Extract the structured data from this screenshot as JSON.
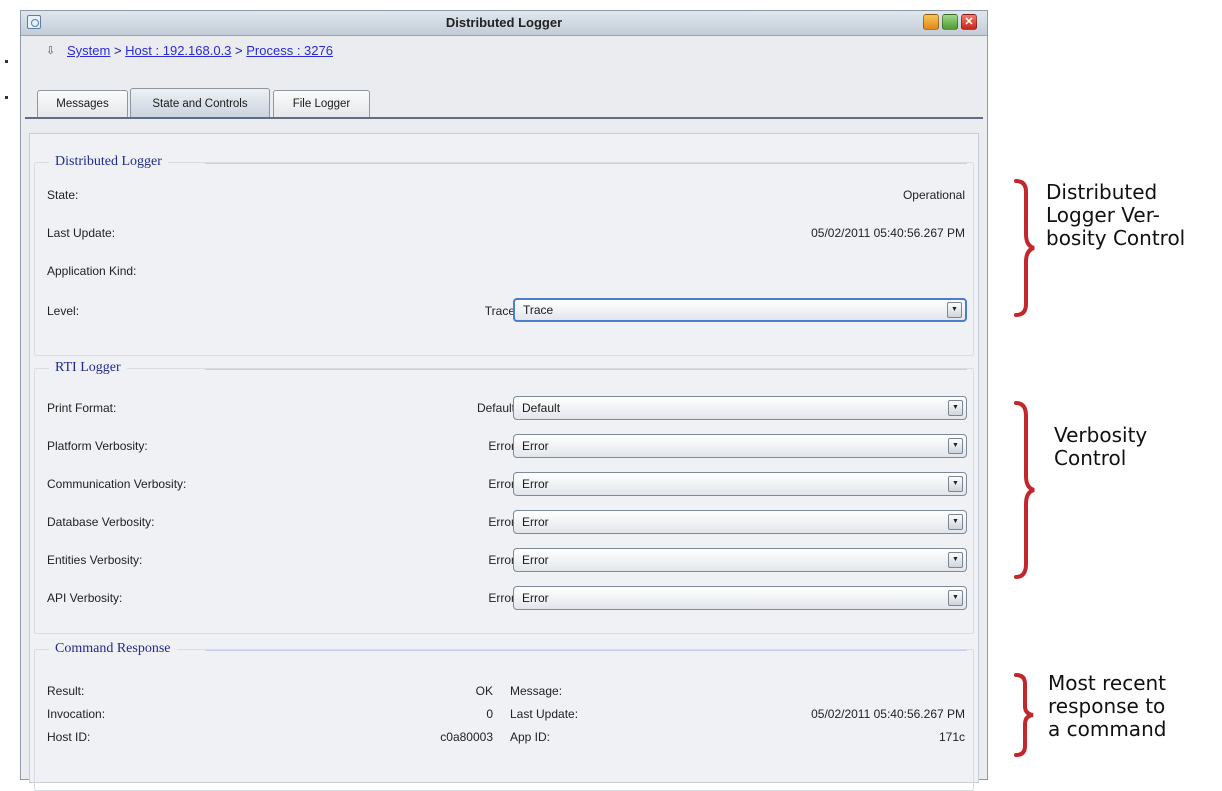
{
  "window": {
    "title": "Distributed Logger"
  },
  "breadcrumb": {
    "items": [
      "System",
      "Host : 192.168.0.3",
      "Process : 3276"
    ],
    "separator": " > "
  },
  "tabs": [
    {
      "label": "Messages",
      "active": false
    },
    {
      "label": "State and Controls",
      "active": true
    },
    {
      "label": "File Logger",
      "active": false
    }
  ],
  "distributed_logger": {
    "title": "Distributed Logger",
    "state_label": "State:",
    "state_value": "Operational",
    "last_update_label": "Last Update:",
    "last_update_value": "05/02/2011 05:40:56.267 PM",
    "app_kind_label": "Application Kind:",
    "level_label": "Level:",
    "level_current": "Trace",
    "level_selected": "Trace"
  },
  "rti_logger": {
    "title": "RTI Logger",
    "rows": [
      {
        "label": "Print Format:",
        "current": "Default",
        "selected": "Default"
      },
      {
        "label": "Platform Verbosity:",
        "current": "Error",
        "selected": "Error"
      },
      {
        "label": "Communication Verbosity:",
        "current": "Error",
        "selected": "Error"
      },
      {
        "label": "Database Verbosity:",
        "current": "Error",
        "selected": "Error"
      },
      {
        "label": "Entities Verbosity:",
        "current": "Error",
        "selected": "Error"
      },
      {
        "label": "API Verbosity:",
        "current": "Error",
        "selected": "Error"
      }
    ]
  },
  "command_response": {
    "title": "Command Response",
    "result_label": "Result:",
    "result_value": "OK",
    "message_label": "Message:",
    "message_value": "",
    "invocation_label": "Invocation:",
    "invocation_value": "0",
    "last_update_label": "Last Update:",
    "last_update_value": "05/02/2011 05:40:56.267 PM",
    "host_id_label": "Host ID:",
    "host_id_value": "c0a80003",
    "app_id_label": "App ID:",
    "app_id_value": "171c"
  },
  "annotations": {
    "logger_verbosity": "Distributed\nLogger Ver-\nbosity Control",
    "verbosity": "Verbosity\nControl",
    "recent_response": "Most recent\nresponse to\na command"
  },
  "colors": {
    "brace": "#c1272d",
    "group_title": "#1f2a8f",
    "link": "#2b2bd6",
    "tab_underline": "#5d6e86"
  }
}
